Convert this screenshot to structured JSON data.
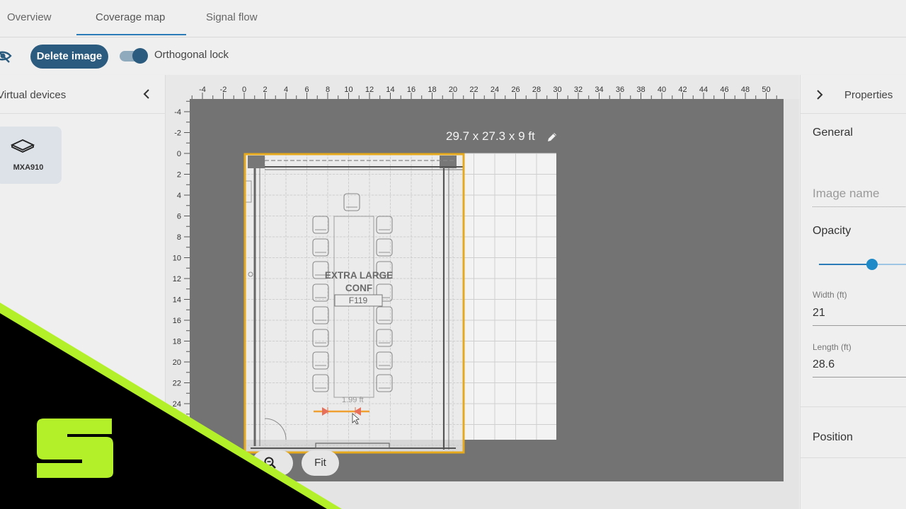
{
  "tabs": [
    {
      "label": "Overview"
    },
    {
      "label": "Coverage map"
    },
    {
      "label": "Signal flow"
    }
  ],
  "toolbar": {
    "delete_label": "Delete image",
    "orthogonal_lock_label": "Orthogonal lock",
    "orthogonal_lock_on": true
  },
  "left_panel": {
    "title": "Virtual devices",
    "device": {
      "name": "MXA910",
      "icon": "device-icon"
    }
  },
  "ruler": {
    "x_ticks": [
      "-4",
      "-2",
      "0",
      "2",
      "4",
      "6",
      "8",
      "10",
      "12",
      "14",
      "16",
      "18",
      "20",
      "22",
      "24",
      "26",
      "28",
      "30",
      "32",
      "34",
      "36",
      "38",
      "40",
      "42",
      "44",
      "46",
      "48",
      "50"
    ],
    "y_ticks": [
      "-4",
      "-2",
      "0",
      "2",
      "4",
      "6",
      "8",
      "10",
      "12",
      "14",
      "16",
      "18",
      "20",
      "22",
      "24"
    ]
  },
  "room": {
    "dimensions": "29.7 x 27.3 x 9 ft"
  },
  "floorplan": {
    "room_line1": "EXTRA LARGE",
    "room_line2": "CONF",
    "room_number": "F119",
    "measure": "1.99 ft"
  },
  "canvas_buttons": {
    "zoom_icon": "zoom-icon",
    "fit_label": "Fit"
  },
  "right_panel": {
    "title": "Properties",
    "general_label": "General",
    "image_name_placeholder": "Image name",
    "opacity_label": "Opacity",
    "opacity_value": 0.6,
    "width_label": "Width (ft)",
    "width_value": "21",
    "length_label": "Length (ft)",
    "length_value": "28.6",
    "position_label": "Position"
  },
  "colors": {
    "accent": "#2a7bb8",
    "button_dark": "#2b5b7e",
    "selection": "#e6a91e",
    "canvas_bg": "#737373",
    "brand_green": "#b3f02a"
  }
}
